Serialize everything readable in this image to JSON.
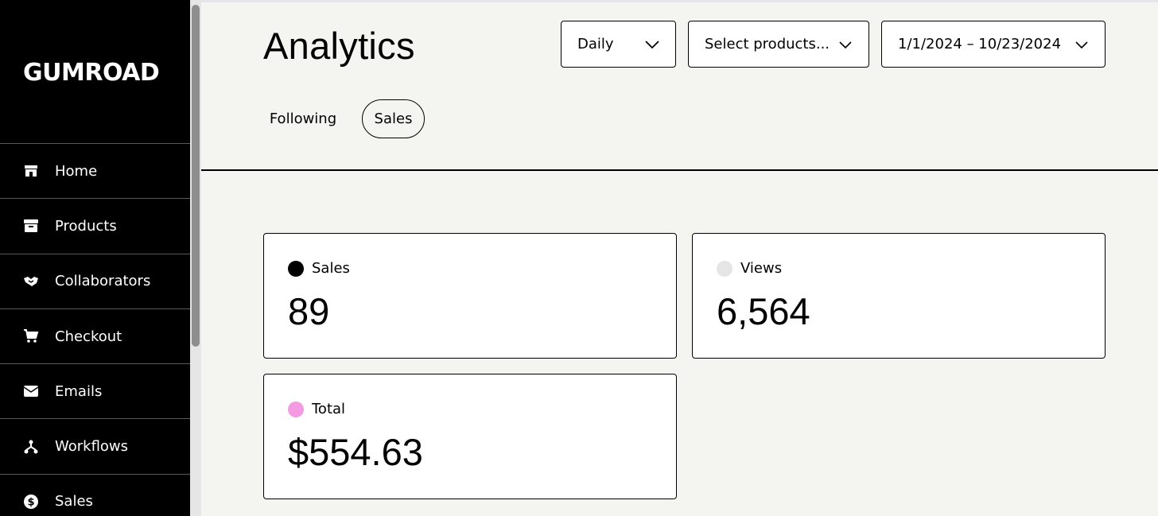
{
  "sidebar": {
    "logo": "GUMROAD",
    "items": [
      {
        "label": "Home",
        "icon": "storefront-icon"
      },
      {
        "label": "Products",
        "icon": "archive-box-icon"
      },
      {
        "label": "Collaborators",
        "icon": "handshake-icon"
      },
      {
        "label": "Checkout",
        "icon": "cart-icon"
      },
      {
        "label": "Emails",
        "icon": "envelope-icon"
      },
      {
        "label": "Workflows",
        "icon": "workflow-icon"
      },
      {
        "label": "Sales",
        "icon": "dollar-circle-icon"
      }
    ]
  },
  "header": {
    "title": "Analytics",
    "interval_select": "Daily",
    "products_select": "Select products...",
    "date_range_select": "1/1/2024 – 10/23/2024"
  },
  "tabs": [
    {
      "label": "Following",
      "active": false
    },
    {
      "label": "Sales",
      "active": true
    }
  ],
  "stats": [
    {
      "label": "Sales",
      "value": "89",
      "dot_color": "#000000"
    },
    {
      "label": "Views",
      "value": "6,564",
      "dot_color": "#e5e5e5"
    },
    {
      "label": "Total",
      "value": "$554.63",
      "dot_color": "#f39ae3"
    }
  ]
}
